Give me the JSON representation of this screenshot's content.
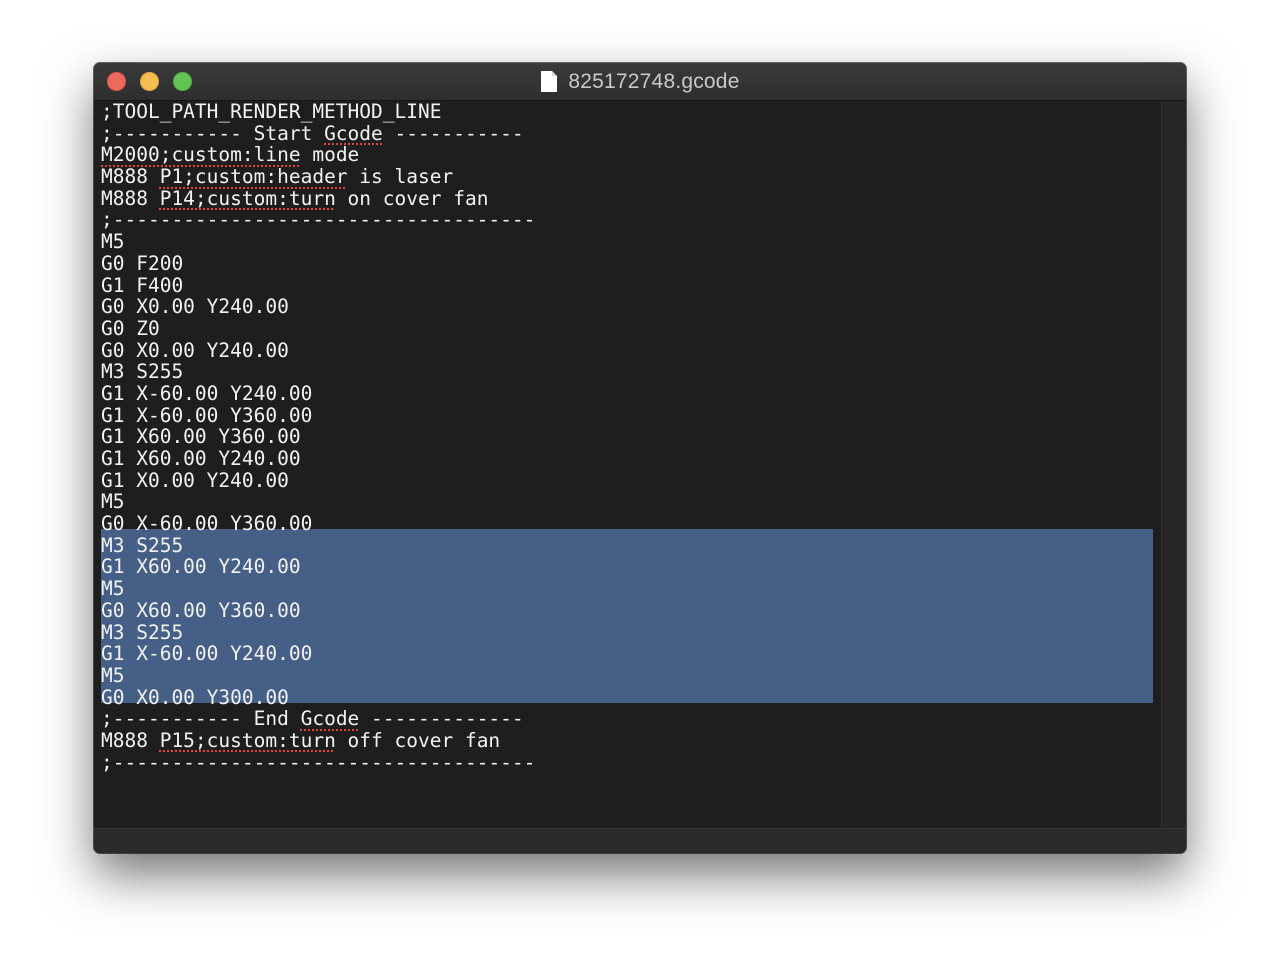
{
  "window": {
    "title": "825172748.gcode",
    "colors": {
      "background": "#1e1e1e",
      "text": "#f2f2f2",
      "selection": "#455f86",
      "close": "#ed6a5e",
      "minimize": "#f5bf4f",
      "maximize": "#61c554"
    }
  },
  "icons": {
    "document": "document-icon",
    "close": "close-button",
    "minimize": "minimize-button",
    "maximize": "zoom-button"
  },
  "editor": {
    "selected_lines": [
      18,
      25
    ],
    "lines": [
      [
        {
          "t": ";TOOL_PATH_RENDER_METHOD_LINE"
        }
      ],
      [
        {
          "t": ";----------- Start "
        },
        {
          "t": "Gcode",
          "s": true
        },
        {
          "t": " -----------"
        }
      ],
      [
        {
          "t": "M2000;custom:line",
          "s": true
        },
        {
          "t": " mode"
        }
      ],
      [
        {
          "t": "M888 "
        },
        {
          "t": "P1;custom:header",
          "s": true
        },
        {
          "t": " is laser"
        }
      ],
      [
        {
          "t": "M888 "
        },
        {
          "t": "P14;custom:turn",
          "s": true
        },
        {
          "t": " on cover fan"
        }
      ],
      [
        {
          "t": ";------------------------------------"
        }
      ],
      [
        {
          "t": "M5"
        }
      ],
      [
        {
          "t": "G0 F200"
        }
      ],
      [
        {
          "t": "G1 F400"
        }
      ],
      [
        {
          "t": "G0 X0.00 Y240.00"
        }
      ],
      [
        {
          "t": "G0 Z0"
        }
      ],
      [
        {
          "t": "G0 X0.00 Y240.00"
        }
      ],
      [
        {
          "t": "M3 S255"
        }
      ],
      [
        {
          "t": "G1 X-60.00 Y240.00"
        }
      ],
      [
        {
          "t": "G1 X-60.00 Y360.00"
        }
      ],
      [
        {
          "t": "G1 X60.00 Y360.00"
        }
      ],
      [
        {
          "t": "G1 X60.00 Y240.00"
        }
      ],
      [
        {
          "t": "G1 X0.00 Y240.00"
        }
      ],
      [
        {
          "t": "M5"
        }
      ],
      [
        {
          "t": "G0 X-60.00 Y360.00"
        }
      ],
      [
        {
          "t": "M3 S255"
        }
      ],
      [
        {
          "t": "G1 X60.00 Y240.00"
        }
      ],
      [
        {
          "t": "M5"
        }
      ],
      [
        {
          "t": "G0 X60.00 Y360.00"
        }
      ],
      [
        {
          "t": "M3 S255"
        }
      ],
      [
        {
          "t": "G1 X-60.00 Y240.00"
        }
      ],
      [
        {
          "t": "M5"
        }
      ],
      [
        {
          "t": "G0 X0.00 Y300.00"
        }
      ],
      [
        {
          "t": ";----------- End "
        },
        {
          "t": "Gcode",
          "s": true
        },
        {
          "t": " -------------"
        }
      ],
      [
        {
          "t": "M888 "
        },
        {
          "t": "P15;custom:turn",
          "s": true
        },
        {
          "t": " off cover fan"
        }
      ],
      [
        {
          "t": ";------------------------------------"
        }
      ]
    ]
  }
}
